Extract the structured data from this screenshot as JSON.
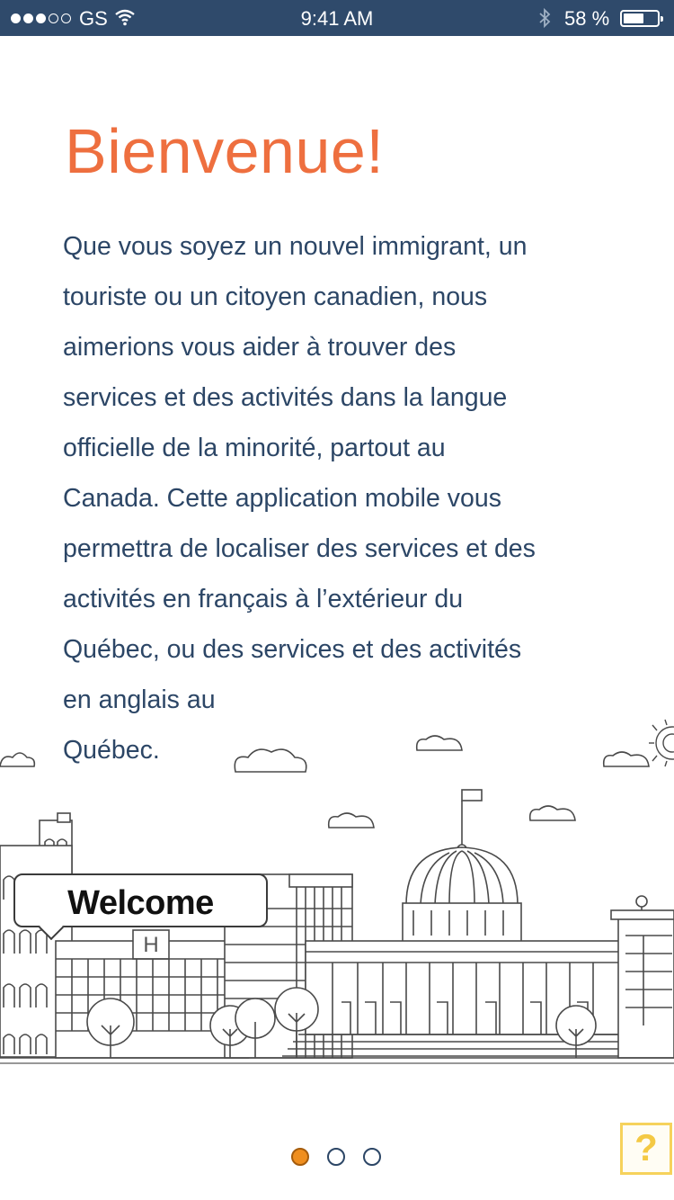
{
  "status_bar": {
    "carrier": "GS",
    "time": "9:41 AM",
    "battery_percent": "58 %",
    "signal_bars_full": 3,
    "signal_bars_total": 5
  },
  "welcome": {
    "title": "Bienvenue!",
    "paragraph_lines": [
      "Que vous soyez un nouvel immigrant, un",
      "touriste ou un citoyen canadien, nous",
      "aimerions vous aider à trouver des",
      "services et des activités dans la langue",
      "officielle de la minorité, partout au",
      "Canada. Cette application mobile vous",
      "permettra de localiser des services et des",
      "activités en français à l’extérieur du",
      "Québec, ou des services et des activités",
      "en anglais au",
      "Québec."
    ]
  },
  "illustration": {
    "bubble_label": "Welcome",
    "hotel_sign": "H"
  },
  "pager": {
    "page_count": 3,
    "current_page": 1
  },
  "help_button": {
    "label": "?"
  },
  "colors": {
    "status_bar_bg": "#2f4a6b",
    "title": "#ee6f3f",
    "body_text": "#2c4666",
    "active_dot": "#ef8e1e",
    "help": "#f4c944"
  }
}
